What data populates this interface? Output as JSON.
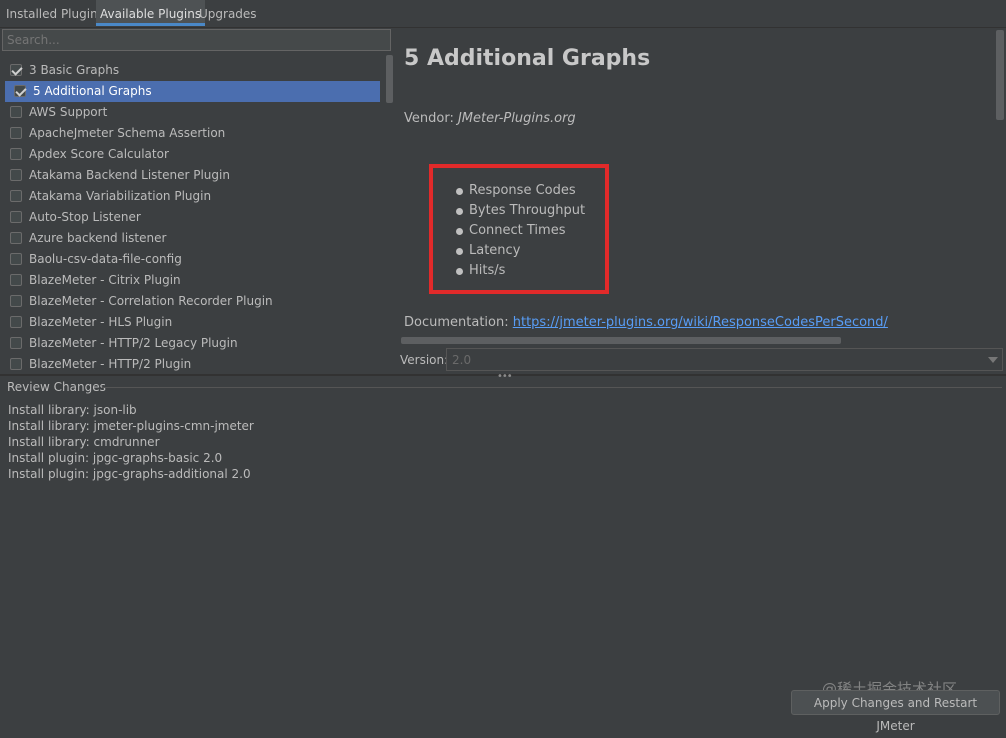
{
  "tabs": [
    {
      "label": "Installed Plugins",
      "active": false
    },
    {
      "label": "Available Plugins",
      "active": true
    },
    {
      "label": "Upgrades",
      "active": false
    }
  ],
  "search": {
    "placeholder": "Search..."
  },
  "plugins": [
    {
      "label": "3 Basic Graphs",
      "checked": true,
      "selected": false
    },
    {
      "label": "5 Additional Graphs",
      "checked": true,
      "selected": true
    },
    {
      "label": "AWS Support",
      "checked": false,
      "selected": false
    },
    {
      "label": "ApacheJmeter Schema Assertion",
      "checked": false,
      "selected": false
    },
    {
      "label": "Apdex Score Calculator",
      "checked": false,
      "selected": false
    },
    {
      "label": "Atakama Backend Listener Plugin",
      "checked": false,
      "selected": false
    },
    {
      "label": "Atakama Variabilization Plugin",
      "checked": false,
      "selected": false
    },
    {
      "label": "Auto-Stop Listener",
      "checked": false,
      "selected": false
    },
    {
      "label": "Azure backend listener",
      "checked": false,
      "selected": false
    },
    {
      "label": "Baolu-csv-data-file-config",
      "checked": false,
      "selected": false
    },
    {
      "label": "BlazeMeter - Citrix Plugin",
      "checked": false,
      "selected": false
    },
    {
      "label": "BlazeMeter - Correlation Recorder Plugin",
      "checked": false,
      "selected": false
    },
    {
      "label": "BlazeMeter - HLS Plugin",
      "checked": false,
      "selected": false
    },
    {
      "label": "BlazeMeter - HTTP/2 Legacy Plugin",
      "checked": false,
      "selected": false
    },
    {
      "label": "BlazeMeter - HTTP/2 Plugin",
      "checked": false,
      "selected": false
    }
  ],
  "details": {
    "title": "5 Additional Graphs",
    "vendor_label": "Vendor:",
    "vendor_name": "JMeter-Plugins.org",
    "features": [
      "Response Codes",
      "Bytes Throughput",
      "Connect Times",
      "Latency",
      "Hits/s"
    ],
    "documentation_label": "Documentation:",
    "documentation_url": "https://jmeter-plugins.org/wiki/ResponseCodesPerSecond/",
    "version_label": "Version:",
    "version_value": "2.0"
  },
  "review": {
    "title": "Review Changes",
    "changes": [
      "Install library: json-lib",
      "Install library: jmeter-plugins-cmn-jmeter",
      "Install library: cmdrunner",
      "Install plugin: jpgc-graphs-basic 2.0",
      "Install plugin: jpgc-graphs-additional 2.0"
    ]
  },
  "apply_button": "Apply Changes and Restart JMeter",
  "watermark": "@稀土掘金技术社区",
  "colors": {
    "accent": "#4b6eaf",
    "highlight_border": "#e22a2a",
    "link": "#589df6",
    "background": "#3c3f41"
  }
}
